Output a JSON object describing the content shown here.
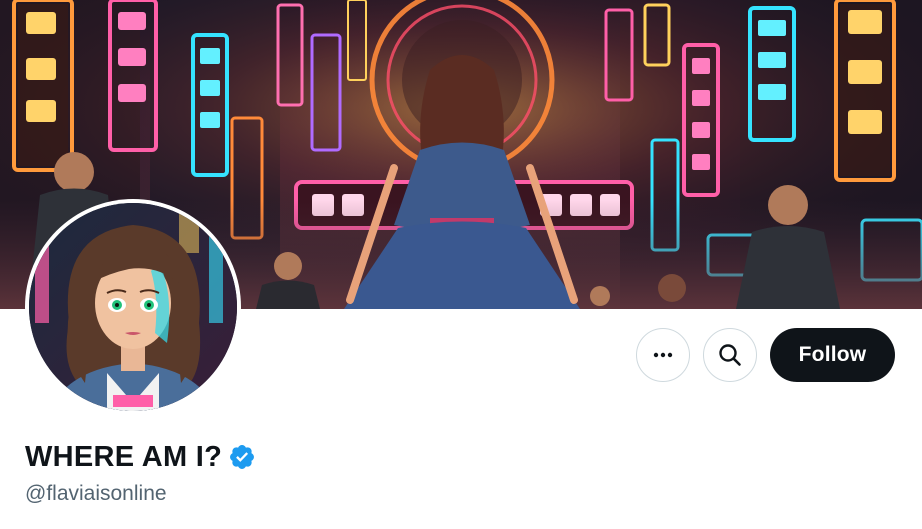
{
  "profile": {
    "display_name": "WHERE AM I?",
    "handle": "@flaviaisonline",
    "verified": true
  },
  "actions": {
    "more_icon": "more-horizontal-icon",
    "search_icon": "search-icon",
    "follow_label": "Follow"
  },
  "colors": {
    "follow_bg": "#0f1419",
    "follow_text": "#ffffff",
    "name_text": "#0f1419",
    "handle_text": "#536471",
    "verified_badge": "#1d9bf0",
    "button_border": "#cfd9de"
  }
}
